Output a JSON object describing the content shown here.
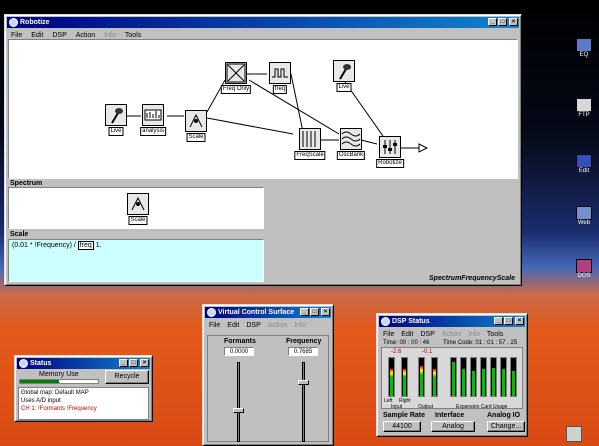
{
  "main_window": {
    "title": "Robotize",
    "menu": [
      "File",
      "Edit",
      "DSP",
      "Action",
      "Info",
      "Tools"
    ],
    "menu_disabled_index": 4,
    "nodes": [
      {
        "label": "Live"
      },
      {
        "label": "analysis"
      },
      {
        "label": "Scale"
      },
      {
        "label": "Freq Only"
      },
      {
        "label": "freq"
      },
      {
        "label": "Live"
      },
      {
        "label": "FreqScale"
      },
      {
        "label": "OscBank"
      },
      {
        "label": "Robotize"
      }
    ],
    "spectrum_title": "Spectrum",
    "spectrum_node_label": "Scale",
    "scale_title": "Scale",
    "scale_expr_prefix": "(0.01 * !Frequency) /",
    "scale_expr_box": "freq",
    "scale_expr_suffix": "1.",
    "status_label": "SpectrumFrequencyScale"
  },
  "vcs": {
    "title": "Virtual Control Surface",
    "menu": [
      "File",
      "Edit",
      "DSP",
      "Action",
      "Info"
    ],
    "col1": {
      "label": "Formants",
      "value": "0.0000",
      "level": 0.4
    },
    "col2": {
      "label": "Frequency",
      "value": "0.7685",
      "level": 0.77
    }
  },
  "status": {
    "title": "Status",
    "memory_label": "Memory Use",
    "recycle": "Recycle",
    "memory_level": 0.5,
    "lines": [
      "Global map: Default MAP",
      "Uses A/D input"
    ],
    "red_line": "CH 1: !Formants !Frequency"
  },
  "dsp": {
    "title": "DSP Status",
    "menu": [
      "File",
      "Edit",
      "DSP",
      "Action",
      "Info",
      "Tools"
    ],
    "time": "Time: 00 : 00 : 46",
    "timecode": "Time Code: 01 : 01 : 57 . 25",
    "peak_left": "-2.6",
    "peak_right": "-0.1",
    "meters_input": [
      0.7,
      0.7
    ],
    "meters_output": [
      0.8,
      0.7
    ],
    "meters_exp": [
      0.9,
      0.7,
      0.65,
      0.7,
      0.75,
      0.7,
      0.65
    ],
    "labels": {
      "left": "Left",
      "right": "Right",
      "input": "Input",
      "output": "Output",
      "expansion": "Expansion Card Usage"
    },
    "sample_rate_label": "Sample Rate",
    "sample_rate": "44100",
    "interface_label": "Interface",
    "interface": "Analog",
    "analog_label": "Analog IO",
    "change": "Change..."
  },
  "desktop": [
    {
      "label": "EQ"
    },
    {
      "label": "FTP"
    },
    {
      "label": "Edit"
    },
    {
      "label": "Web"
    },
    {
      "label": "DOS"
    }
  ],
  "colors": {
    "title_start": "#000080",
    "title_end": "#1084d0",
    "scale_bg": "#ccffff",
    "red": "#c00000"
  }
}
